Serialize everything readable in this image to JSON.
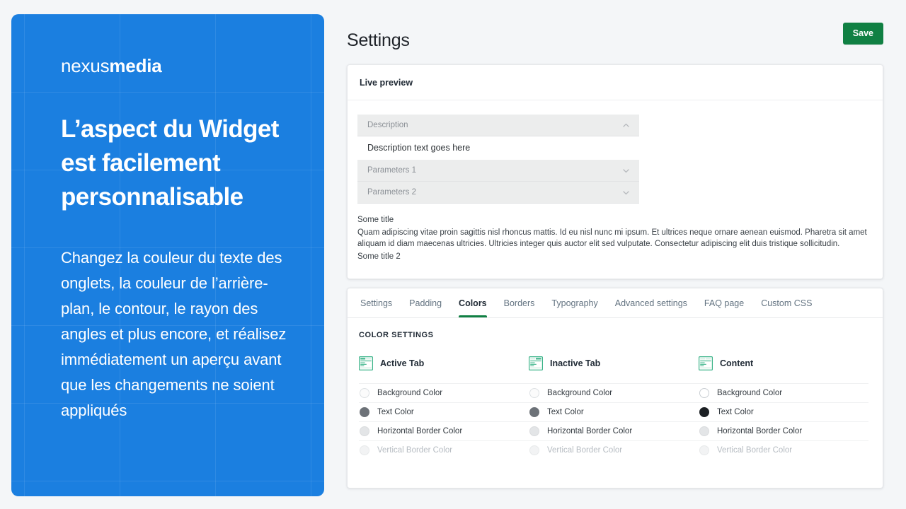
{
  "promo": {
    "brand_light": "nexus",
    "brand_bold": "media",
    "headline": "L’aspect du Widget est facilement personnalisable",
    "body": "Changez la couleur du texte des onglets, la couleur de l’arrière-plan, le contour, le rayon des angles et plus encore, et réalisez immédiatement un aperçu avant que les changements ne soient appliqués",
    "bg_color": "#1b7fe0"
  },
  "header": {
    "title": "Settings",
    "save_label": "Save",
    "save_color": "#108043"
  },
  "preview_card": {
    "title": "Live preview",
    "accordion": [
      {
        "label": "Description",
        "state": "expanded",
        "icon": "chevron-up-icon"
      },
      {
        "label": "Parameters 1",
        "state": "collapsed",
        "icon": "chevron-down-icon"
      },
      {
        "label": "Parameters 2",
        "state": "collapsed",
        "icon": "chevron-down-icon"
      }
    ],
    "panel_text": "Description text goes here",
    "text_block": {
      "title": "Some title",
      "paragraph": "Quam adipiscing vitae proin sagittis nisl rhoncus mattis. Id eu nisl nunc mi ipsum. Et ultrices neque ornare aenean euismod. Pharetra sit amet aliquam id diam maecenas ultricies. Ultricies integer quis auctor elit sed vulputate. Consectetur adipiscing elit duis tristique sollicitudin.",
      "title2": "Some title 2"
    }
  },
  "tabs": [
    {
      "label": "Settings",
      "active": false
    },
    {
      "label": "Padding",
      "active": false
    },
    {
      "label": "Colors",
      "active": true
    },
    {
      "label": "Borders",
      "active": false
    },
    {
      "label": "Typography",
      "active": false
    },
    {
      "label": "Advanced settings",
      "active": false
    },
    {
      "label": "FAQ page",
      "active": false
    },
    {
      "label": "Custom CSS",
      "active": false
    }
  ],
  "colors_panel": {
    "section_label": "COLOR SETTINGS",
    "columns": [
      {
        "title": "Active Tab",
        "icon": "widget-active-tab-icon",
        "rows": [
          {
            "label": "Background Color",
            "swatch": "#fbfbfb",
            "swatch_class": "sw-white",
            "disabled": false
          },
          {
            "label": "Text Color",
            "swatch": "#6d7278",
            "swatch_class": "sw-gray",
            "disabled": false
          },
          {
            "label": "Horizontal Border Color",
            "swatch": "#e3e5e7",
            "swatch_class": "sw-lgray",
            "disabled": false
          },
          {
            "label": "Vertical Border Color",
            "swatch": "#f2f3f4",
            "swatch_class": "sw-faint",
            "disabled": true
          }
        ]
      },
      {
        "title": "Inactive Tab",
        "icon": "widget-inactive-tab-icon",
        "rows": [
          {
            "label": "Background Color",
            "swatch": "#fbfbfb",
            "swatch_class": "sw-white",
            "disabled": false
          },
          {
            "label": "Text Color",
            "swatch": "#6d7278",
            "swatch_class": "sw-gray",
            "disabled": false
          },
          {
            "label": "Horizontal Border Color",
            "swatch": "#e3e5e7",
            "swatch_class": "sw-lgray",
            "disabled": false
          },
          {
            "label": "Vertical Border Color",
            "swatch": "#f2f3f4",
            "swatch_class": "sw-faint",
            "disabled": true
          }
        ]
      },
      {
        "title": "Content",
        "icon": "widget-content-icon",
        "rows": [
          {
            "label": "Background Color",
            "swatch": "#ffffff",
            "swatch_class": "sw-white-pure",
            "disabled": false
          },
          {
            "label": "Text Color",
            "swatch": "#1c2024",
            "swatch_class": "sw-black",
            "disabled": false
          },
          {
            "label": "Horizontal Border Color",
            "swatch": "#e3e5e7",
            "swatch_class": "sw-lgray",
            "disabled": false
          },
          {
            "label": "Vertical Border Color",
            "swatch": "#f2f3f4",
            "swatch_class": "sw-faint",
            "disabled": true
          }
        ]
      }
    ]
  }
}
